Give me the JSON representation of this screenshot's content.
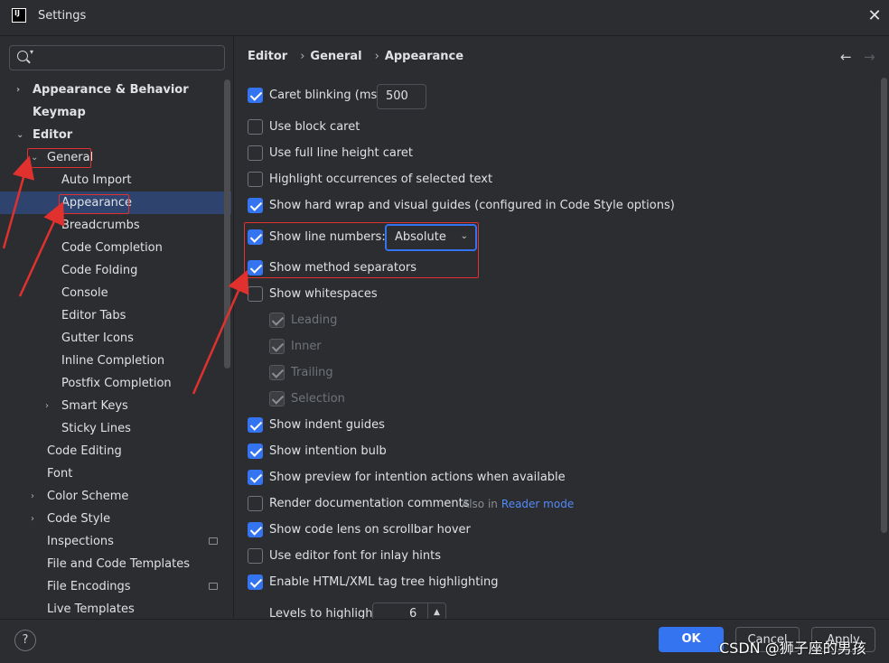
{
  "window": {
    "title": "Settings",
    "app_icon_text": "IJ",
    "close_icon": "close-icon"
  },
  "search": {
    "placeholder": "",
    "icon": "search-icon"
  },
  "tree": [
    {
      "label": "Appearance & Behavior",
      "bold": true,
      "arrow": "›"
    },
    {
      "label": "Keymap",
      "bold": true,
      "arrow": ""
    },
    {
      "label": "Editor",
      "bold": true,
      "arrow": "⌄"
    },
    {
      "label": "General",
      "bold": false,
      "arrow": "⌄"
    },
    {
      "label": "Auto Import",
      "bold": false,
      "arrow": ""
    },
    {
      "label": "Appearance",
      "bold": false,
      "arrow": "",
      "selected": true
    },
    {
      "label": "Breadcrumbs",
      "bold": false,
      "arrow": ""
    },
    {
      "label": "Code Completion",
      "bold": false,
      "arrow": ""
    },
    {
      "label": "Code Folding",
      "bold": false,
      "arrow": ""
    },
    {
      "label": "Console",
      "bold": false,
      "arrow": ""
    },
    {
      "label": "Editor Tabs",
      "bold": false,
      "arrow": ""
    },
    {
      "label": "Gutter Icons",
      "bold": false,
      "arrow": ""
    },
    {
      "label": "Inline Completion",
      "bold": false,
      "arrow": ""
    },
    {
      "label": "Postfix Completion",
      "bold": false,
      "arrow": ""
    },
    {
      "label": "Smart Keys",
      "bold": false,
      "arrow": "›"
    },
    {
      "label": "Sticky Lines",
      "bold": false,
      "arrow": ""
    },
    {
      "label": "Code Editing",
      "bold": false,
      "arrow": ""
    },
    {
      "label": "Font",
      "bold": false,
      "arrow": ""
    },
    {
      "label": "Color Scheme",
      "bold": false,
      "arrow": "›"
    },
    {
      "label": "Code Style",
      "bold": false,
      "arrow": "›"
    },
    {
      "label": "Inspections",
      "bold": false,
      "arrow": ""
    },
    {
      "label": "File and Code Templates",
      "bold": false,
      "arrow": ""
    },
    {
      "label": "File Encodings",
      "bold": false,
      "arrow": ""
    },
    {
      "label": "Live Templates",
      "bold": false,
      "arrow": ""
    }
  ],
  "breadcrumb": [
    "Editor",
    "General",
    "Appearance"
  ],
  "breadcrumb_sep": "›",
  "nav": {
    "back": "←",
    "forward": "→"
  },
  "options": {
    "caret_blinking": {
      "label": "Caret blinking (ms):",
      "checked": true,
      "value": "500"
    },
    "block_caret": {
      "label": "Use block caret",
      "checked": false
    },
    "full_line_caret": {
      "label": "Use full line height caret",
      "checked": false
    },
    "highlight_occurrences": {
      "label": "Highlight occurrences of selected text",
      "checked": false
    },
    "hard_wrap": {
      "label": "Show hard wrap and visual guides (configured in Code Style options)",
      "checked": true
    },
    "line_numbers": {
      "label": "Show line numbers:",
      "checked": true,
      "value": "Absolute"
    },
    "method_separators": {
      "label": "Show method separators",
      "checked": true
    },
    "whitespaces": {
      "label": "Show whitespaces",
      "checked": false
    },
    "leading": {
      "label": "Leading",
      "checked": true,
      "enabled": false
    },
    "inner": {
      "label": "Inner",
      "checked": true,
      "enabled": false
    },
    "trailing": {
      "label": "Trailing",
      "checked": true,
      "enabled": false
    },
    "selection": {
      "label": "Selection",
      "checked": true,
      "enabled": false
    },
    "indent_guides": {
      "label": "Show indent guides",
      "checked": true
    },
    "intention_bulb": {
      "label": "Show intention bulb",
      "checked": true
    },
    "intention_preview": {
      "label": "Show preview for intention actions when available",
      "checked": true
    },
    "render_docs": {
      "label": "Render documentation comments",
      "checked": false,
      "hint_prefix": "Also in",
      "hint_link": "Reader mode"
    },
    "code_lens": {
      "label": "Show code lens on scrollbar hover",
      "checked": true
    },
    "inlay_font": {
      "label": "Use editor font for inlay hints",
      "checked": false
    },
    "tag_tree": {
      "label": "Enable HTML/XML tag tree highlighting",
      "checked": true
    },
    "levels": {
      "label": "Levels to highlight:",
      "value": "6"
    }
  },
  "footer": {
    "help": "?",
    "ok": "OK",
    "cancel": "Cancel",
    "apply": "Apply"
  },
  "watermark": "CSDN @狮子座的男孩",
  "colors": {
    "accent": "#3574f0",
    "annotation": "#e0312f",
    "background": "#2b2d30"
  }
}
